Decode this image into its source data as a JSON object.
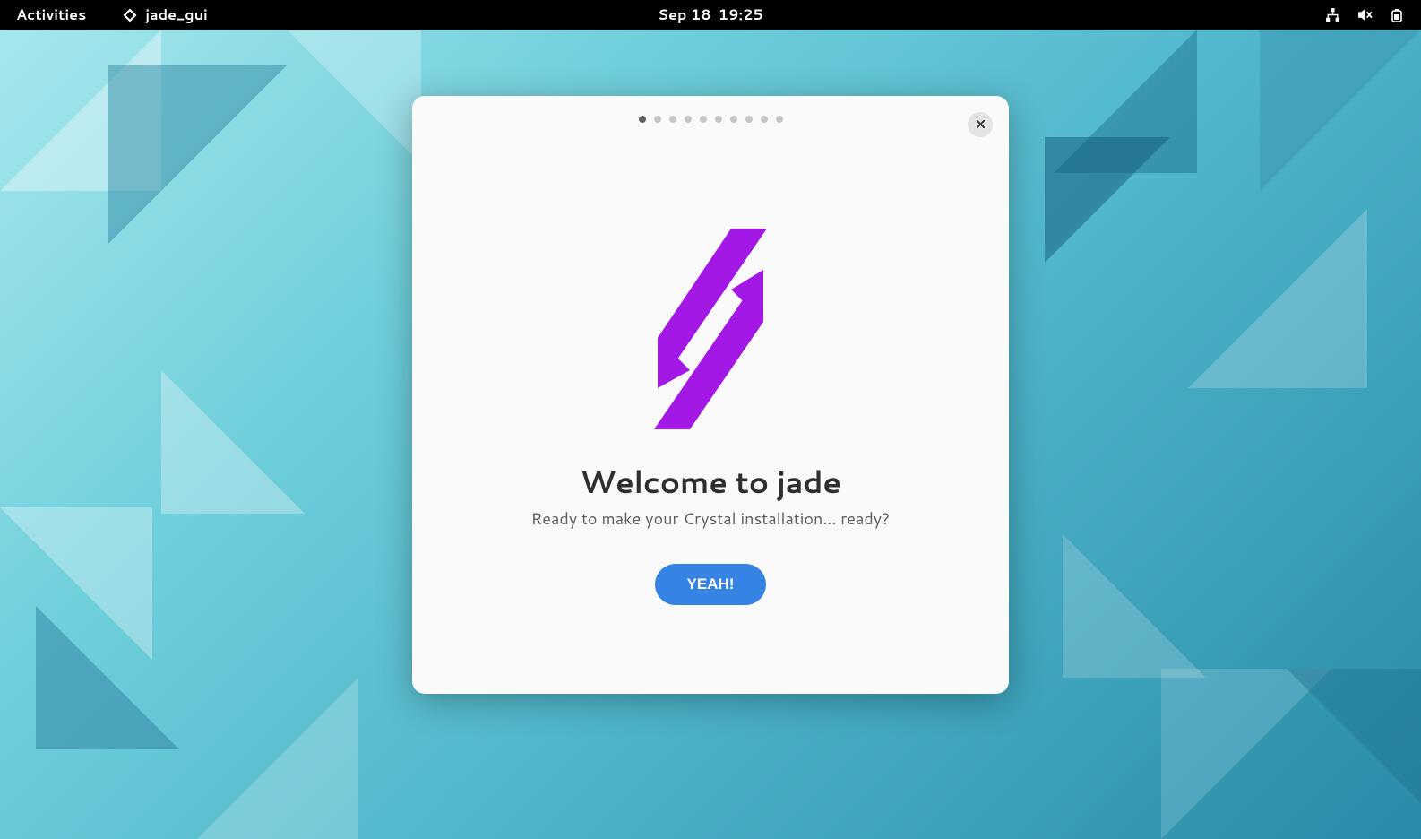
{
  "topbar": {
    "activities_label": "Activities",
    "app_name": "jade_gui",
    "date": "Sep 18",
    "time": "19:25"
  },
  "dialog": {
    "page_count": 10,
    "active_page": 0,
    "title": "Welcome to jade",
    "subtitle": "Ready to make your Crystal installation... ready?",
    "cta_label": "YEAH!"
  },
  "colors": {
    "accent_purple": "#a418e6",
    "button_blue": "#3584e4"
  }
}
